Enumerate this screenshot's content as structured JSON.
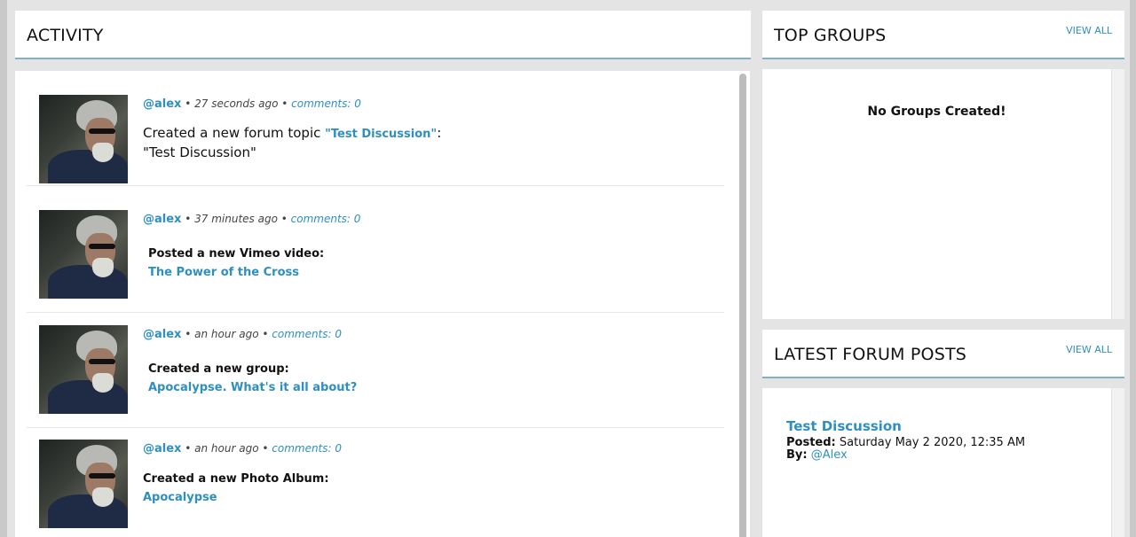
{
  "activity": {
    "title": "ACTIVITY",
    "items": [
      {
        "user": "@alex",
        "time": " • 27 seconds ago • ",
        "comments": "comments: 0",
        "prefix": "Created a new forum topic ",
        "link": "\"Test Discussion\"",
        "suffix": ":",
        "body": "\"Test Discussion\""
      },
      {
        "user": "@alex",
        "time": " • 37 minutes ago • ",
        "comments": "comments: 0",
        "title": "Posted a new Vimeo video:",
        "link": "The Power of the Cross"
      },
      {
        "user": "@alex",
        "time": " • an hour ago • ",
        "comments": "comments: 0",
        "title": "Created a new group:",
        "link": "Apocalypse. What's it all about?"
      },
      {
        "user": "@alex",
        "time": " • an hour ago • ",
        "comments": "comments: 0",
        "title": "Created a new Photo Album:",
        "link": "Apocalypse"
      }
    ]
  },
  "top_groups": {
    "title": "TOP GROUPS",
    "view_all": "VIEW ALL",
    "empty": "No Groups Created!"
  },
  "forum": {
    "title": "LATEST FORUM POSTS",
    "view_all": "VIEW ALL",
    "post_title": "Test Discussion",
    "posted_label": "Posted:",
    "posted_value": " Saturday May 2 2020, 12:35 AM",
    "by_label": "By:",
    "by_value": " @Alex"
  },
  "colors": {
    "accent": "#2e8fc0",
    "rule": "#7fb2c9",
    "background": "#e4e4e4"
  }
}
